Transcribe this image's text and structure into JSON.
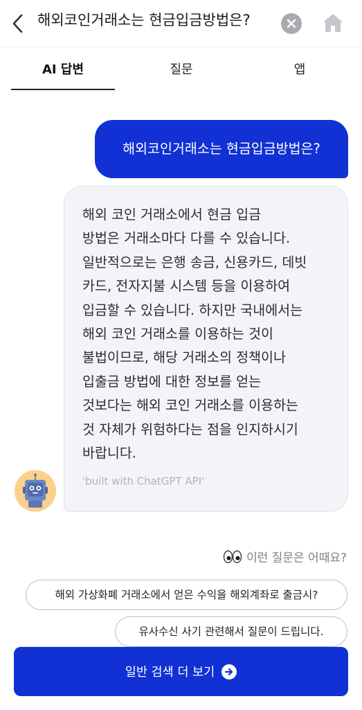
{
  "header": {
    "query": "해외코인거래소는 현금입금방법은?",
    "back_icon": "chevron-left-icon",
    "clear_icon": "clear-x-icon",
    "home_icon": "home-icon"
  },
  "tabs": [
    {
      "label": "AI 답변",
      "active": true
    },
    {
      "label": "질문",
      "active": false
    },
    {
      "label": "앱",
      "active": false
    }
  ],
  "chat": {
    "user_message": "해외코인거래소는 현금입금방법은?",
    "ai_answer": "해외 코인 거래소에서 현금 입금\n방법은 거래소마다 다를 수 있습니다.\n일반적으로는 은행 송금, 신용카드, 데빗\n카드, 전자지불 시스템 등을 이용하여\n입금할 수 있습니다. 하지만 국내에서는\n해외 코인 거래소를 이용하는 것이\n불법이므로, 해당 거래소의 정책이나\n입출금 방법에 대한 정보를 얻는\n것보다는 해외 코인 거래소를 이용하는\n것 자체가 위험하다는 점을 인지하시기\n바랍니다.",
    "credit": "'built with ChatGPT API'"
  },
  "suggestions": {
    "title": "이런 질문은 어때요?",
    "icon": "eyes-icon",
    "items": [
      "해외 가상화폐 거래소에서 얻은 수익을 해외계좌로 출금시?",
      "유사수신 사기 관련해서 질문이 드립니다."
    ]
  },
  "cta": {
    "label": "일반 검색 더 보기",
    "icon": "arrow-right-circle-icon"
  },
  "colors": {
    "accent": "#1131d4",
    "avatar_bg": "#fbd08a",
    "bubble_bg": "#f3f4f7"
  }
}
